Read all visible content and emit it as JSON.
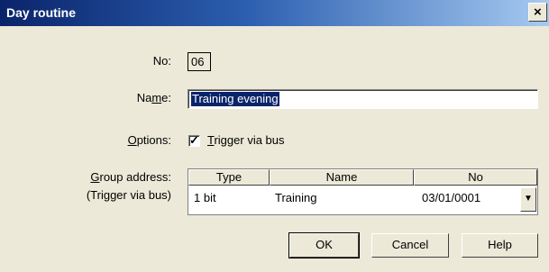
{
  "window": {
    "title": "Day routine",
    "close_glyph": "×"
  },
  "form": {
    "no_label_pre": "No:",
    "no_value": "06",
    "name_label_pre": "Na",
    "name_label_accel": "m",
    "name_label_post": "e:",
    "name_value": "Training evening",
    "options_label_accel": "O",
    "options_label_post": "ptions:",
    "checkbox_checked": true,
    "checkbox_accel": "T",
    "checkbox_label_post": "rigger via bus",
    "group_label_accel": "G",
    "group_label_post": "roup address:",
    "group_sublabel": "(Trigger via bus)"
  },
  "grid": {
    "columns": [
      "Type",
      "Name",
      "No"
    ],
    "row": {
      "type": "1 bit",
      "name": "Training",
      "no": "03/01/0001"
    }
  },
  "buttons": {
    "ok": "OK",
    "cancel": "Cancel",
    "help": "Help"
  },
  "colors": {
    "title_start": "#0a246a",
    "title_end": "#a6caf0",
    "dialog_bg": "#ece9d8",
    "selection": "#0a246a"
  }
}
